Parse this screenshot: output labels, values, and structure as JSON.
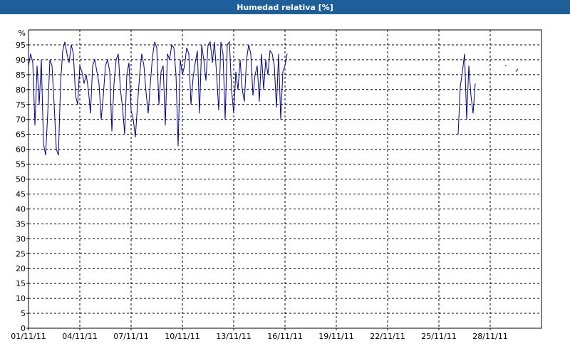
{
  "window": {
    "title": "Humedad relativa [%]"
  },
  "chart_data": {
    "type": "line",
    "title": "Humedad relativa [%]",
    "xlabel": "",
    "ylabel": "%",
    "ylim": [
      0,
      95
    ],
    "grid": true,
    "x_tick_labels": [
      "01/11/11",
      "04/11/11",
      "07/11/11",
      "10/11/11",
      "13/11/11",
      "16/11/11",
      "19/11/11",
      "22/11/11",
      "25/11/11",
      "28/11/11"
    ],
    "y_ticks": [
      0,
      5,
      10,
      15,
      20,
      25,
      30,
      35,
      40,
      45,
      50,
      55,
      60,
      65,
      70,
      75,
      80,
      85,
      90,
      95
    ],
    "line_color": "#00008b",
    "series": [
      {
        "segments": [
          {
            "start_day": 1,
            "step_days": 0.125,
            "values": [
              88,
              92,
              89,
              68,
              88,
              75,
              90,
              62,
              58,
              72,
              90,
              88,
              75,
              60,
              58,
              82,
              93,
              96,
              92,
              89,
              95,
              92,
              78,
              75,
              88,
              86,
              82,
              85,
              80,
              72,
              88,
              90,
              86,
              82,
              70,
              78,
              88,
              90,
              86,
              66,
              82,
              90,
              92,
              80,
              74,
              65,
              85,
              89,
              73,
              70,
              64,
              75,
              85,
              92,
              88,
              79,
              72,
              82,
              91,
              96,
              94,
              75,
              86,
              88,
              68,
              92,
              90,
              95,
              94,
              85,
              61,
              90,
              85,
              88,
              94,
              92,
              75,
              84,
              89,
              93,
              72,
              95,
              90,
              83,
              95,
              96,
              89,
              96,
              85,
              73,
              96,
              92,
              70,
              95,
              96,
              80,
              72,
              86,
              80,
              90,
              80,
              76,
              90,
              95,
              92,
              78,
              85,
              88,
              76,
              92,
              80,
              90,
              85,
              93,
              92,
              88,
              74,
              92,
              70,
              86,
              88,
              92
            ]
          },
          {
            "start_day": 26.125,
            "step_days": 0.125,
            "values": [
              65,
              81,
              86,
              92,
              70,
              88,
              78,
              72,
              82
            ]
          },
          {
            "start_day": 28.875,
            "step_days": 0.25,
            "values": [
              88
            ]
          },
          {
            "start_day": 29.5,
            "step_days": 0.125,
            "values": [
              86,
              87
            ]
          }
        ]
      }
    ]
  }
}
